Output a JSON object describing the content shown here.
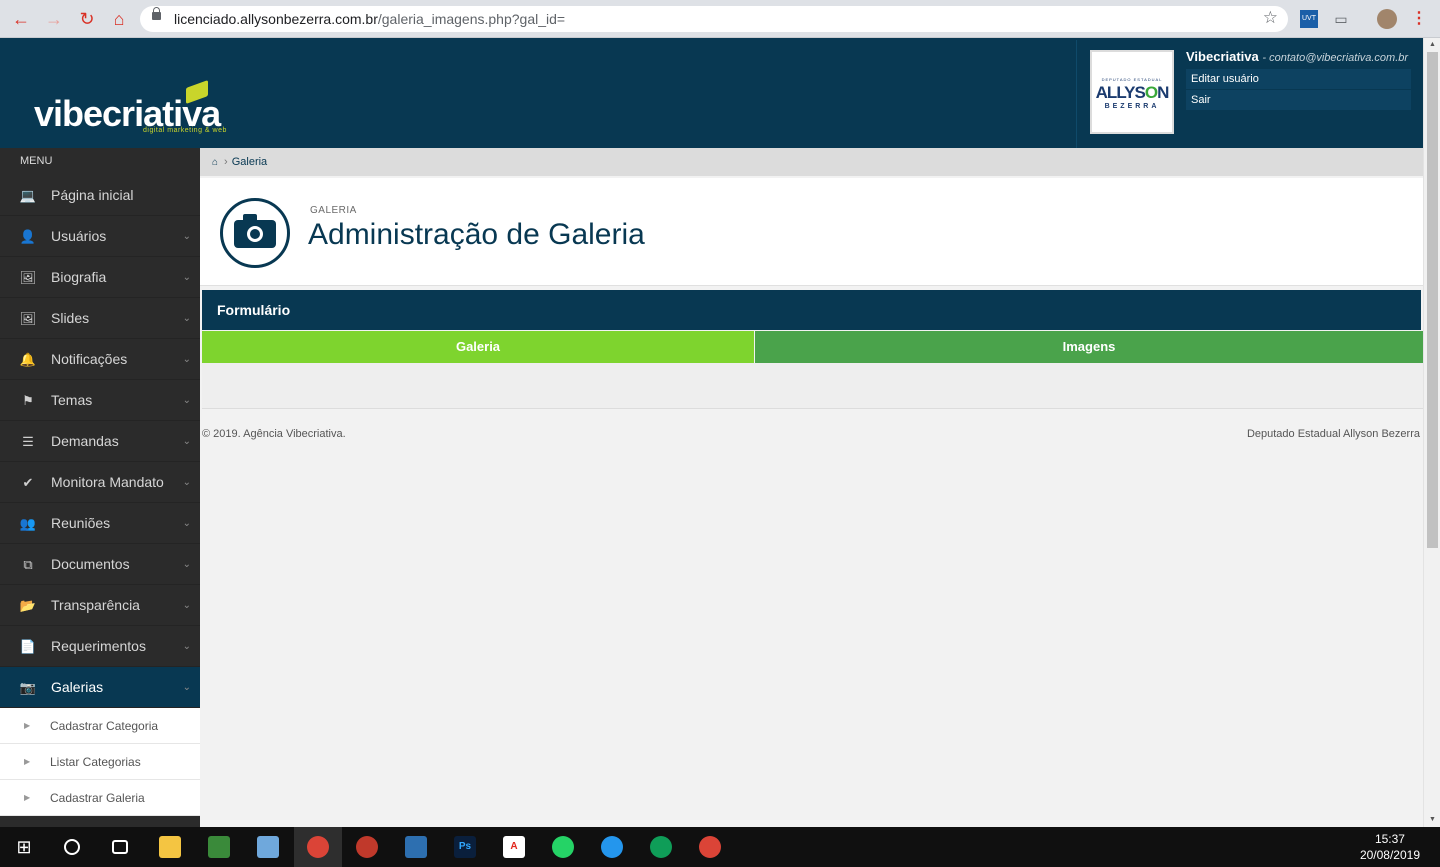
{
  "browser": {
    "url_host": "licenciado.allysonbezerra.com.br",
    "url_path": "/galeria_imagens.php?gal_id=",
    "ext_uvt": "UVT"
  },
  "header": {
    "logo_text": "vibecriativa",
    "logo_tagline": "digital marketing & web",
    "avatar_top": "DEPUTADO ESTADUAL",
    "avatar_name_a": "ALLYS",
    "avatar_name_b": "O",
    "avatar_name_c": "N",
    "avatar_bottom": "BEZERRA",
    "user_name": "Vibecriativa",
    "user_email": "- contato@vibecriativa.com.br",
    "edit_user": "Editar usuário",
    "logout": "Sair"
  },
  "sidebar": {
    "title": "MENU",
    "items": [
      {
        "label": "Página inicial",
        "icon": "laptop-icon",
        "glyph": "💻"
      },
      {
        "label": "Usuários",
        "icon": "user-icon",
        "glyph": "👤"
      },
      {
        "label": "Biografia",
        "icon": "image-icon",
        "glyph": "🖼"
      },
      {
        "label": "Slides",
        "icon": "image-icon",
        "glyph": "🖼"
      },
      {
        "label": "Notificações",
        "icon": "bell-icon",
        "glyph": "🔔"
      },
      {
        "label": "Temas",
        "icon": "flag-icon",
        "glyph": "⚑"
      },
      {
        "label": "Demandas",
        "icon": "list-icon",
        "glyph": "☰"
      },
      {
        "label": "Monitora Mandato",
        "icon": "check-icon",
        "glyph": "✔"
      },
      {
        "label": "Reuniões",
        "icon": "users-icon",
        "glyph": "👥"
      },
      {
        "label": "Documentos",
        "icon": "copy-icon",
        "glyph": "⧉"
      },
      {
        "label": "Transparência",
        "icon": "folder-open-icon",
        "glyph": "📂"
      },
      {
        "label": "Requerimentos",
        "icon": "file-icon",
        "glyph": "📄"
      },
      {
        "label": "Galerias",
        "icon": "camera-icon",
        "glyph": "📷"
      }
    ],
    "sub_items": [
      "Cadastrar Categoria",
      "Listar Categorias",
      "Cadastrar Galeria"
    ]
  },
  "breadcrumb": {
    "current": "Galeria"
  },
  "page_head": {
    "sup": "GALERIA",
    "title": "Administração de Galeria"
  },
  "form": {
    "title": "Formulário"
  },
  "tabs": {
    "galeria": "Galeria",
    "imagens": "Imagens"
  },
  "colors": {
    "primary": "#083852",
    "tab_active": "#7ed42e",
    "tab_inactive": "#4aa34b",
    "sidebar": "#2b2b2b"
  },
  "footer": {
    "left": "© 2019. Agência Vibecriativa.",
    "right": "Deputado Estadual Allyson Bezerra"
  },
  "taskbar": {
    "time": "15:37",
    "date": "20/08/2019"
  }
}
